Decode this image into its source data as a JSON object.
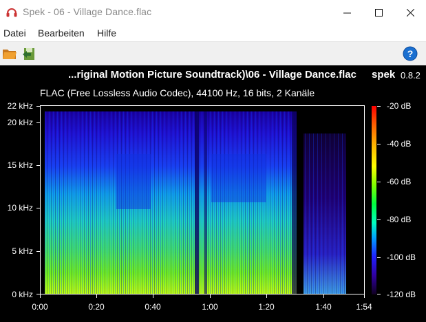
{
  "window": {
    "title": "Spek - 06 - Village Dance.flac",
    "controls": {
      "minimize": "—",
      "maximize": "☐",
      "close": "✕"
    },
    "icon": "headphones-icon"
  },
  "menu": {
    "items": [
      "Datei",
      "Bearbeiten",
      "Hilfe"
    ]
  },
  "toolbar": {
    "open_icon": "folder-open-icon",
    "save_icon": "save-image-icon",
    "help_icon": "help-icon"
  },
  "spectrogram": {
    "file_title": "...riginal Motion Picture Soundtrack)\\06 - Village Dance.flac",
    "brand": "spek",
    "version": "0.8.2",
    "file_info": "FLAC (Free Lossless Audio Codec), 44100 Hz, 16 bits, 2 Kanäle",
    "y_ticks": [
      "22 kHz",
      "20 kHz",
      "15 kHz",
      "10 kHz",
      "5 kHz",
      "0 kHz"
    ],
    "x_ticks": [
      "0:00",
      "0:20",
      "0:40",
      "1:00",
      "1:20",
      "1:40",
      "1:54"
    ],
    "db_ticks": [
      "-20 dB",
      "-40 dB",
      "-60 dB",
      "-80 dB",
      "-100 dB",
      "-120 dB"
    ],
    "colors": {
      "background": "#000000",
      "text": "#ffffff"
    }
  }
}
